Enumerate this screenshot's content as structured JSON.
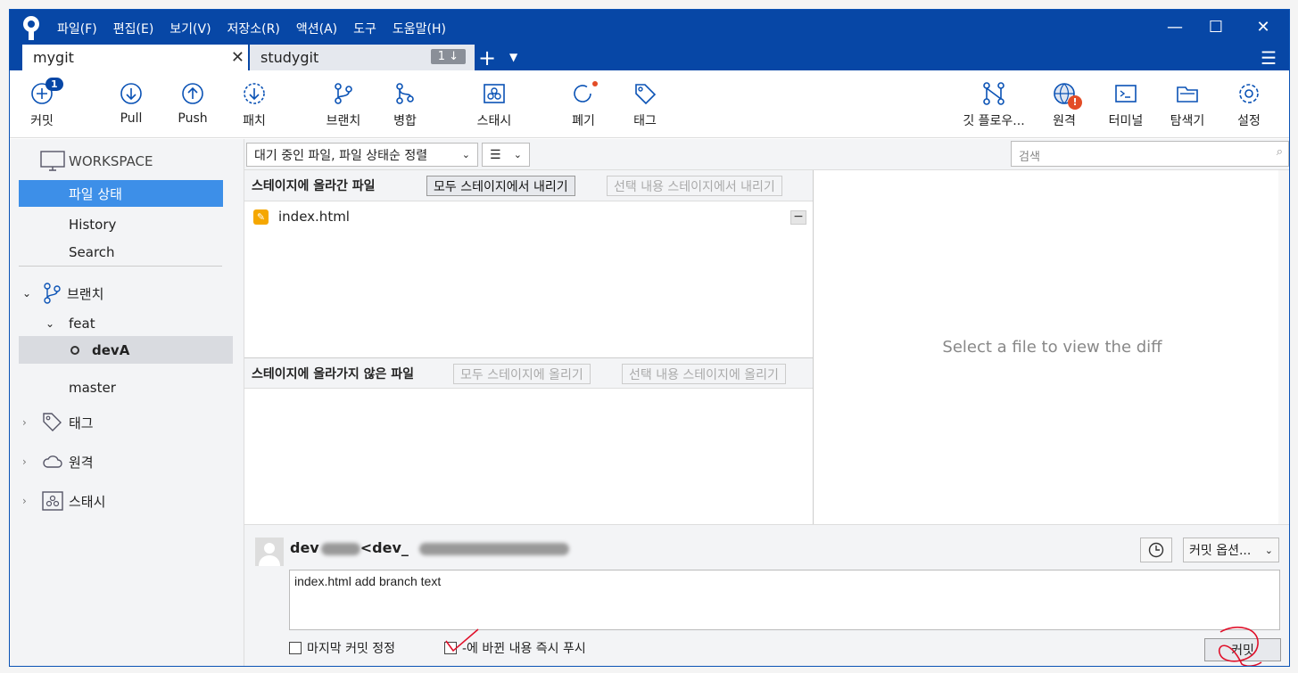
{
  "menu": [
    "파일(F)",
    "편집(E)",
    "보기(V)",
    "저장소(R)",
    "액션(A)",
    "도구",
    "도움말(H)"
  ],
  "tabs": {
    "active": "mygit",
    "inactive": "studygit",
    "inactive_badge": "1 ↓"
  },
  "toolbar": {
    "commit": "커밋",
    "commit_badge": "1",
    "pull": "Pull",
    "push": "Push",
    "patch": "패치",
    "branch": "브랜치",
    "merge": "병합",
    "stash": "스태시",
    "discard": "폐기",
    "tag": "태그",
    "gitflow": "깃 플로우...",
    "remote": "원격",
    "remote_alert": "!",
    "terminal": "터미널",
    "explorer": "탐색기",
    "settings": "설정"
  },
  "sidebar": {
    "workspace": "WORKSPACE",
    "file_status": "파일 상태",
    "history": "History",
    "search": "Search",
    "branches": "브랜치",
    "feat": "feat",
    "devA": "devA",
    "master": "master",
    "tags": "태그",
    "remotes": "원격",
    "stashes": "스태시"
  },
  "filter": {
    "sort": "대기 중인 파일, 파일 상태순 정렬",
    "view": "☰",
    "search_placeholder": "검색"
  },
  "staged": {
    "title": "스테이지에 올라간 파일",
    "unstage_all": "모두 스테이지에서 내리기",
    "unstage_sel": "선택 내용 스테이지에서 내리기",
    "files": [
      "index.html"
    ]
  },
  "unstaged": {
    "title": "스테이지에 올라가지 않은 파일",
    "stage_all": "모두 스테이지에 올리기",
    "stage_sel": "선택 내용 스테이지에 올리기"
  },
  "diff": {
    "placeholder": "Select a file to view the diff"
  },
  "commit": {
    "author_a": "dev",
    "author_b": "<dev_",
    "options": "커밋 옵션...",
    "message": "index.html add branch text",
    "amend": "마지막 커밋 정정",
    "push_now": "-에 바뀐 내용 즉시 푸시",
    "button": "커밋"
  },
  "colors": {
    "titlebar": "#0747a6",
    "selected": "#3d8fe8",
    "annotation": "#e0102a"
  }
}
